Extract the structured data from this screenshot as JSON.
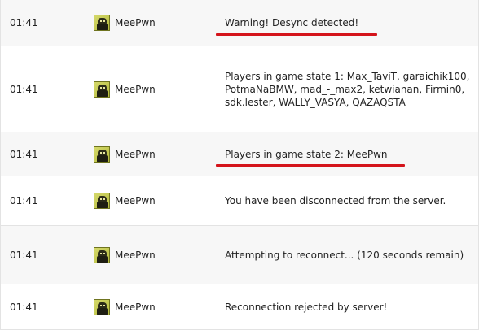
{
  "rows": [
    {
      "time": "01:41",
      "player": "MeePwn",
      "message": "Warning! Desync detected!"
    },
    {
      "time": "01:41",
      "player": "MeePwn",
      "message": "Players in game state 1: Max_TaviT, garaichik100, PotmaNaBMW, mad_-_max2, ketwianan, Firmin0, sdk.lester, WALLY_VASYA, QAZAQSTA"
    },
    {
      "time": "01:41",
      "player": "MeePwn",
      "message": "Players in game state 2: MeePwn"
    },
    {
      "time": "01:41",
      "player": "MeePwn",
      "message": "You have been disconnected from the server."
    },
    {
      "time": "01:41",
      "player": "MeePwn",
      "message": "Attempting to reconnect... (120 seconds remain)"
    },
    {
      "time": "01:41",
      "player": "MeePwn",
      "message": "Reconnection rejected by server!"
    }
  ],
  "highlight_color": "#d4141b",
  "avatar_icon": "player-avatar-icon"
}
